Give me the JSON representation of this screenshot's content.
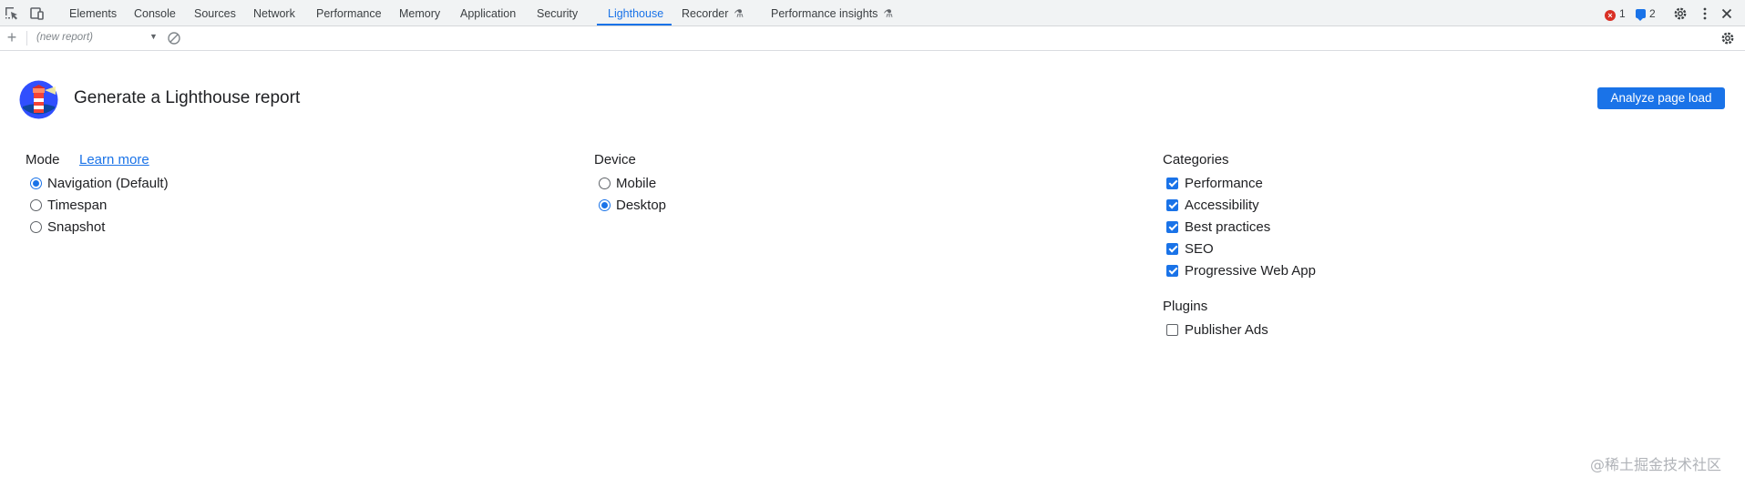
{
  "devtools": {
    "tabs": [
      {
        "label": "Elements"
      },
      {
        "label": "Console"
      },
      {
        "label": "Sources"
      },
      {
        "label": "Network"
      },
      {
        "label": "Performance"
      },
      {
        "label": "Memory"
      },
      {
        "label": "Application"
      },
      {
        "label": "Security"
      },
      {
        "label": "Lighthouse",
        "active": true
      },
      {
        "label": "Recorder",
        "experimental": true
      },
      {
        "label": "Performance insights",
        "experimental": true
      }
    ],
    "error_count": "1",
    "message_count": "2",
    "icons": {
      "inspect": "inspect-element-icon",
      "device": "device-toolbar-icon",
      "error": "error-icon",
      "message": "message-icon",
      "settings": "gear-icon",
      "more": "more-vertical-icon",
      "close": "close-icon",
      "flask": "flask-icon"
    },
    "accent_color": "#1a73e8",
    "error_color": "#d93025"
  },
  "report_toolbar": {
    "report_select_value": "(new report)",
    "icons": {
      "new": "plus-icon",
      "clear": "block-icon",
      "settings": "gear-icon"
    }
  },
  "lighthouse": {
    "title": "Generate a Lighthouse report",
    "analyze_button": "Analyze page load",
    "logo_icon": "lighthouse-logo-icon",
    "mode": {
      "heading": "Mode",
      "learn_more": "Learn more",
      "options": [
        {
          "label": "Navigation (Default)",
          "checked": true
        },
        {
          "label": "Timespan",
          "checked": false
        },
        {
          "label": "Snapshot",
          "checked": false
        }
      ]
    },
    "device": {
      "heading": "Device",
      "options": [
        {
          "label": "Mobile",
          "checked": false
        },
        {
          "label": "Desktop",
          "checked": true
        }
      ]
    },
    "categories": {
      "heading": "Categories",
      "options": [
        {
          "label": "Performance",
          "checked": true
        },
        {
          "label": "Accessibility",
          "checked": true
        },
        {
          "label": "Best practices",
          "checked": true
        },
        {
          "label": "SEO",
          "checked": true
        },
        {
          "label": "Progressive Web App",
          "checked": true
        }
      ]
    },
    "plugins": {
      "heading": "Plugins",
      "options": [
        {
          "label": "Publisher Ads",
          "checked": false
        }
      ]
    }
  },
  "watermark": "@稀土掘金技术社区"
}
